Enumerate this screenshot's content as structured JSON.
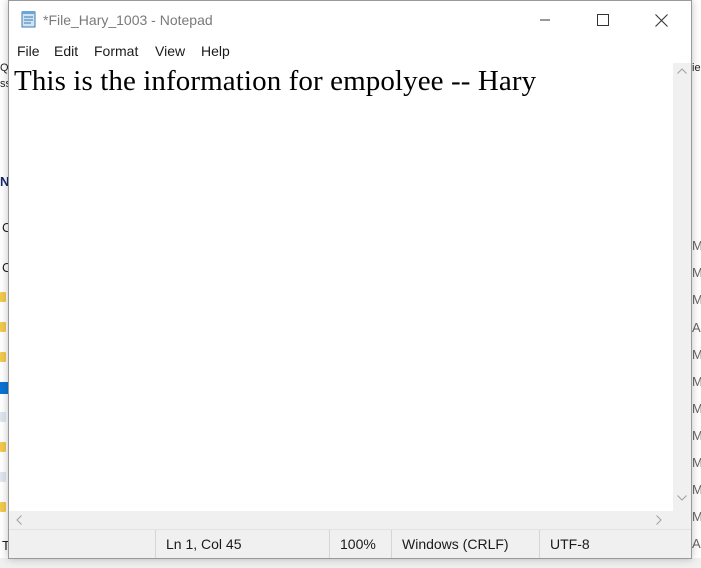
{
  "window": {
    "title": "*File_Hary_1003 - Notepad"
  },
  "menu": [
    "File",
    "Edit",
    "Format",
    "View",
    "Help"
  ],
  "editor": {
    "text": "This is the information for empolyee -- Hary"
  },
  "status": {
    "position": "Ln 1, Col 45",
    "zoom": "100%",
    "line_ending": "Windows (CRLF)",
    "encoding": "UTF-8"
  },
  "background": {
    "left_fragments": [
      "Qu",
      "ss",
      "N",
      "C",
      "C",
      "T"
    ],
    "right_fragments": [
      "ie",
      "M",
      "M",
      "M",
      "A",
      "M",
      "M",
      "M",
      "M",
      "M",
      "M",
      "M",
      "A"
    ]
  },
  "colors": {
    "accent": "#0a74d1",
    "status_bar": "#f0f0f0",
    "title_text": "#7a7a7a"
  }
}
